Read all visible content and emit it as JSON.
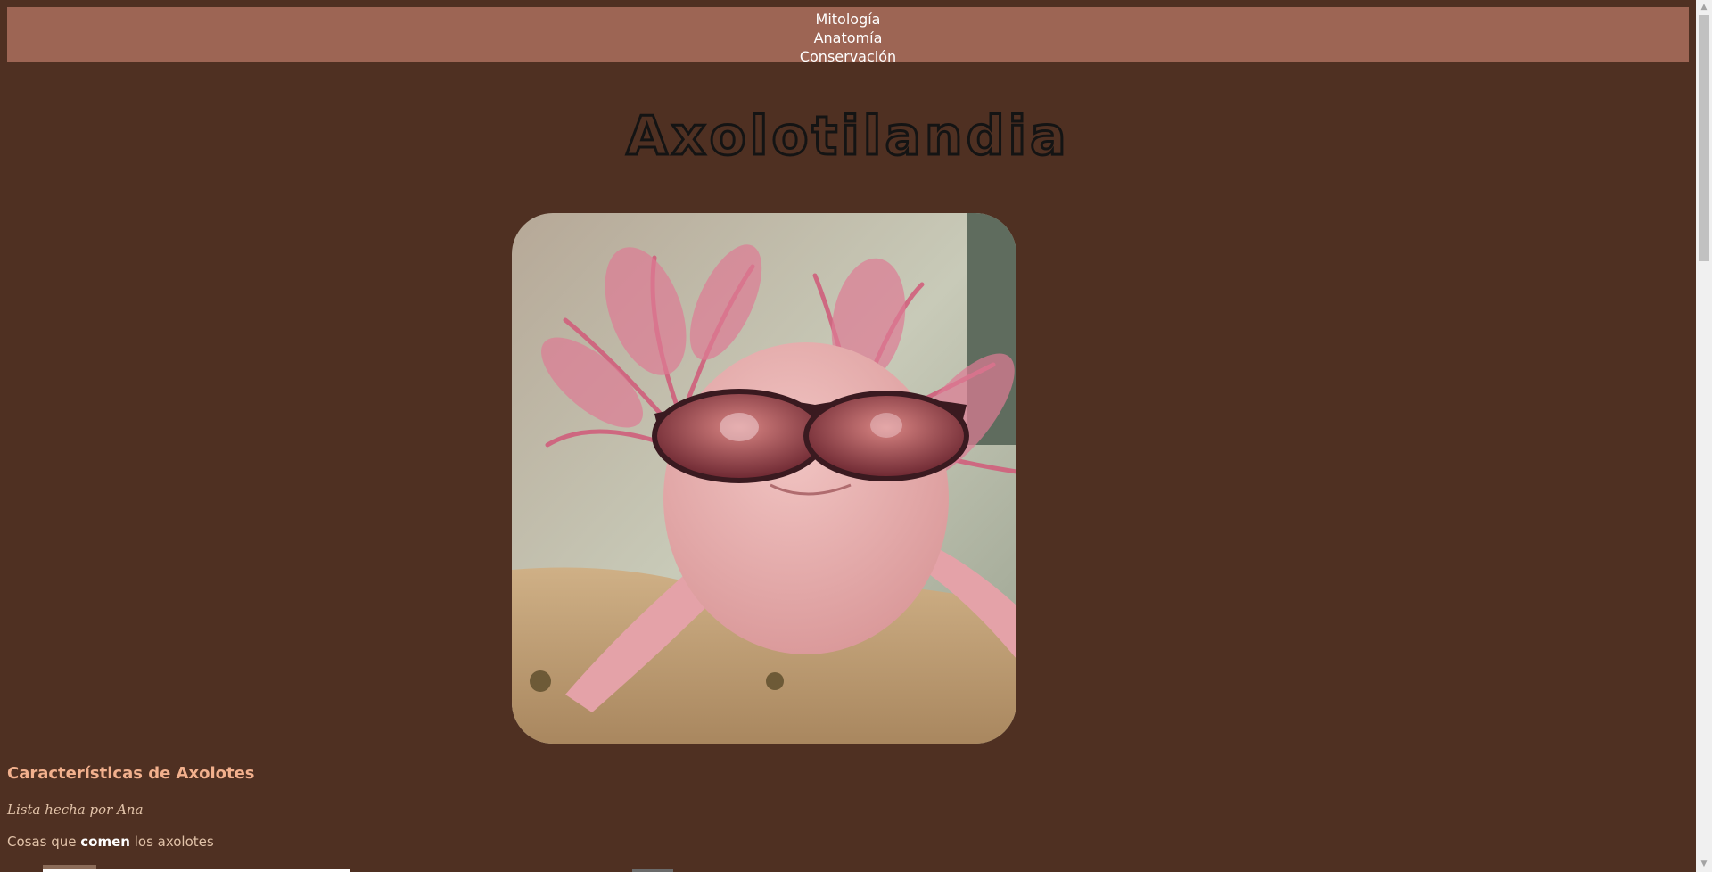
{
  "nav": {
    "items": [
      "Mitología",
      "Anatomía",
      "Conservación"
    ]
  },
  "site": {
    "title": "Axolotilandia"
  },
  "hero": {
    "alt": "Axolote con gafas de sol"
  },
  "section": {
    "title": "Características de Axolotes",
    "byline": "Lista hecha por Ana",
    "eat_prefix": "Cosas que ",
    "eat_bold": "comen",
    "eat_suffix": " los axolotes"
  },
  "colors": {
    "background": "#4f3022",
    "nav_background": "#9d6554",
    "heading": "#f2b08d",
    "text": "#e1c2a8"
  },
  "icons": {
    "scroll_up": "chevron-up-icon",
    "scroll_down": "chevron-down-icon"
  }
}
